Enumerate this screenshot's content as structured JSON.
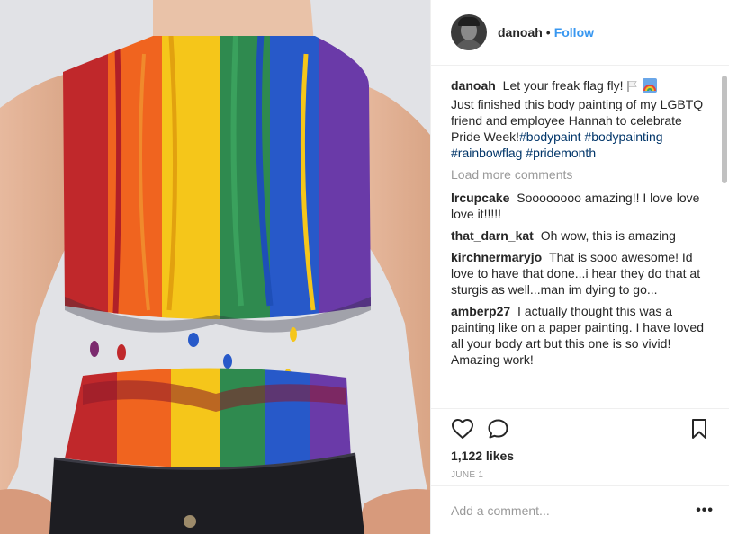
{
  "post": {
    "username": "danoah",
    "separator": "•",
    "follow_label": "Follow",
    "caption": {
      "username": "danoah",
      "text": "Let your freak flag fly!",
      "text2": "Just finished this body painting of my LGBTQ friend and employee Hannah to celebrate Pride Week!",
      "hashtags": [
        "#bodypaint",
        "#bodypainting",
        "#rainbowflag",
        "#pridemonth"
      ]
    },
    "load_more_label": "Load more comments",
    "comments": [
      {
        "username": "lrcupcake",
        "text": "Soooooooo amazing!! I love love love it!!!!!"
      },
      {
        "username": "that_darn_kat",
        "text": "Oh wow, this is amazing"
      },
      {
        "username": "kirchnermaryjo",
        "text": "That is sooo awesome! Id love to have that done...i hear they do that at sturgis as well...man im dying to go..."
      },
      {
        "username": "amberp27",
        "text": "I actually thought this was a painting like on a paper painting. I have loved all your body art but this one is so vivid! Amazing work!"
      }
    ],
    "likes": "1,122 likes",
    "date": "June 1",
    "add_comment_placeholder": "Add a comment...",
    "more_label": "•••"
  },
  "icons": {
    "like": "heart-icon",
    "comment": "comment-bubble-icon",
    "save": "bookmark-icon",
    "options": "more-options-icon"
  },
  "colors": {
    "link_blue": "#3897f0",
    "hashtag_blue": "#003569",
    "muted_gray": "#999999",
    "rainbow": [
      "#c0282b",
      "#f0641f",
      "#f5c61a",
      "#2f8a4f",
      "#2759c9",
      "#6a3aa8"
    ]
  }
}
